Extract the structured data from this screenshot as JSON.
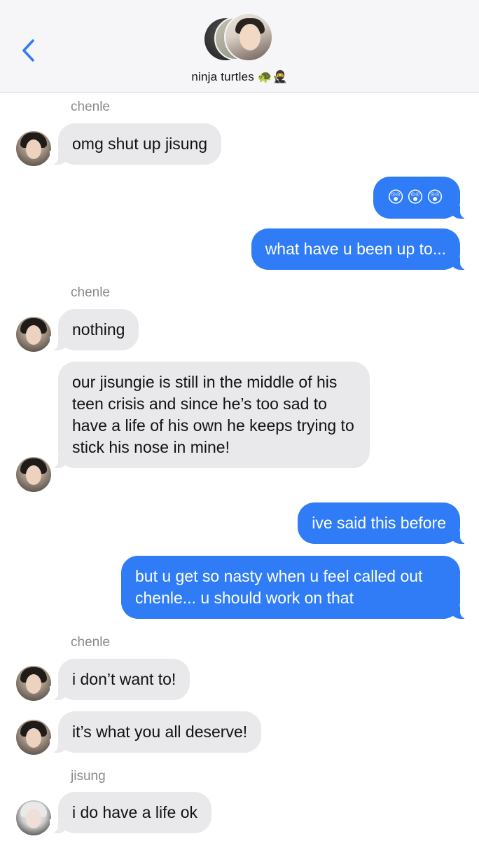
{
  "header": {
    "back_icon": "chevron-left-icon",
    "group_name": "ninja turtles",
    "group_emoji": "🐢🥷",
    "accent_color": "#2f7cf6"
  },
  "messages": [
    {
      "sender": "chenle",
      "direction": "in",
      "text": "omg shut up jisung"
    },
    {
      "direction": "out",
      "text": "😲😲😲"
    },
    {
      "direction": "out",
      "text": "what have u been up to..."
    },
    {
      "sender": "chenle",
      "direction": "in",
      "text": "nothing"
    },
    {
      "direction": "in",
      "text": "our jisungie is still in the middle of his teen crisis and since he’s too sad to have a life of his own he keeps trying to stick his nose in mine!"
    },
    {
      "direction": "out",
      "text": "ive said this before"
    },
    {
      "direction": "out",
      "text": "but u get so nasty when u feel called out chenle... u should work on that"
    },
    {
      "sender": "chenle",
      "direction": "in",
      "text": "i don’t want to!"
    },
    {
      "direction": "in",
      "text": "it’s what you all deserve!"
    },
    {
      "sender": "jisung",
      "direction": "in",
      "text": "i do have a life ok"
    }
  ],
  "labels": {
    "chenle": "chenle",
    "jisung": "jisung"
  }
}
